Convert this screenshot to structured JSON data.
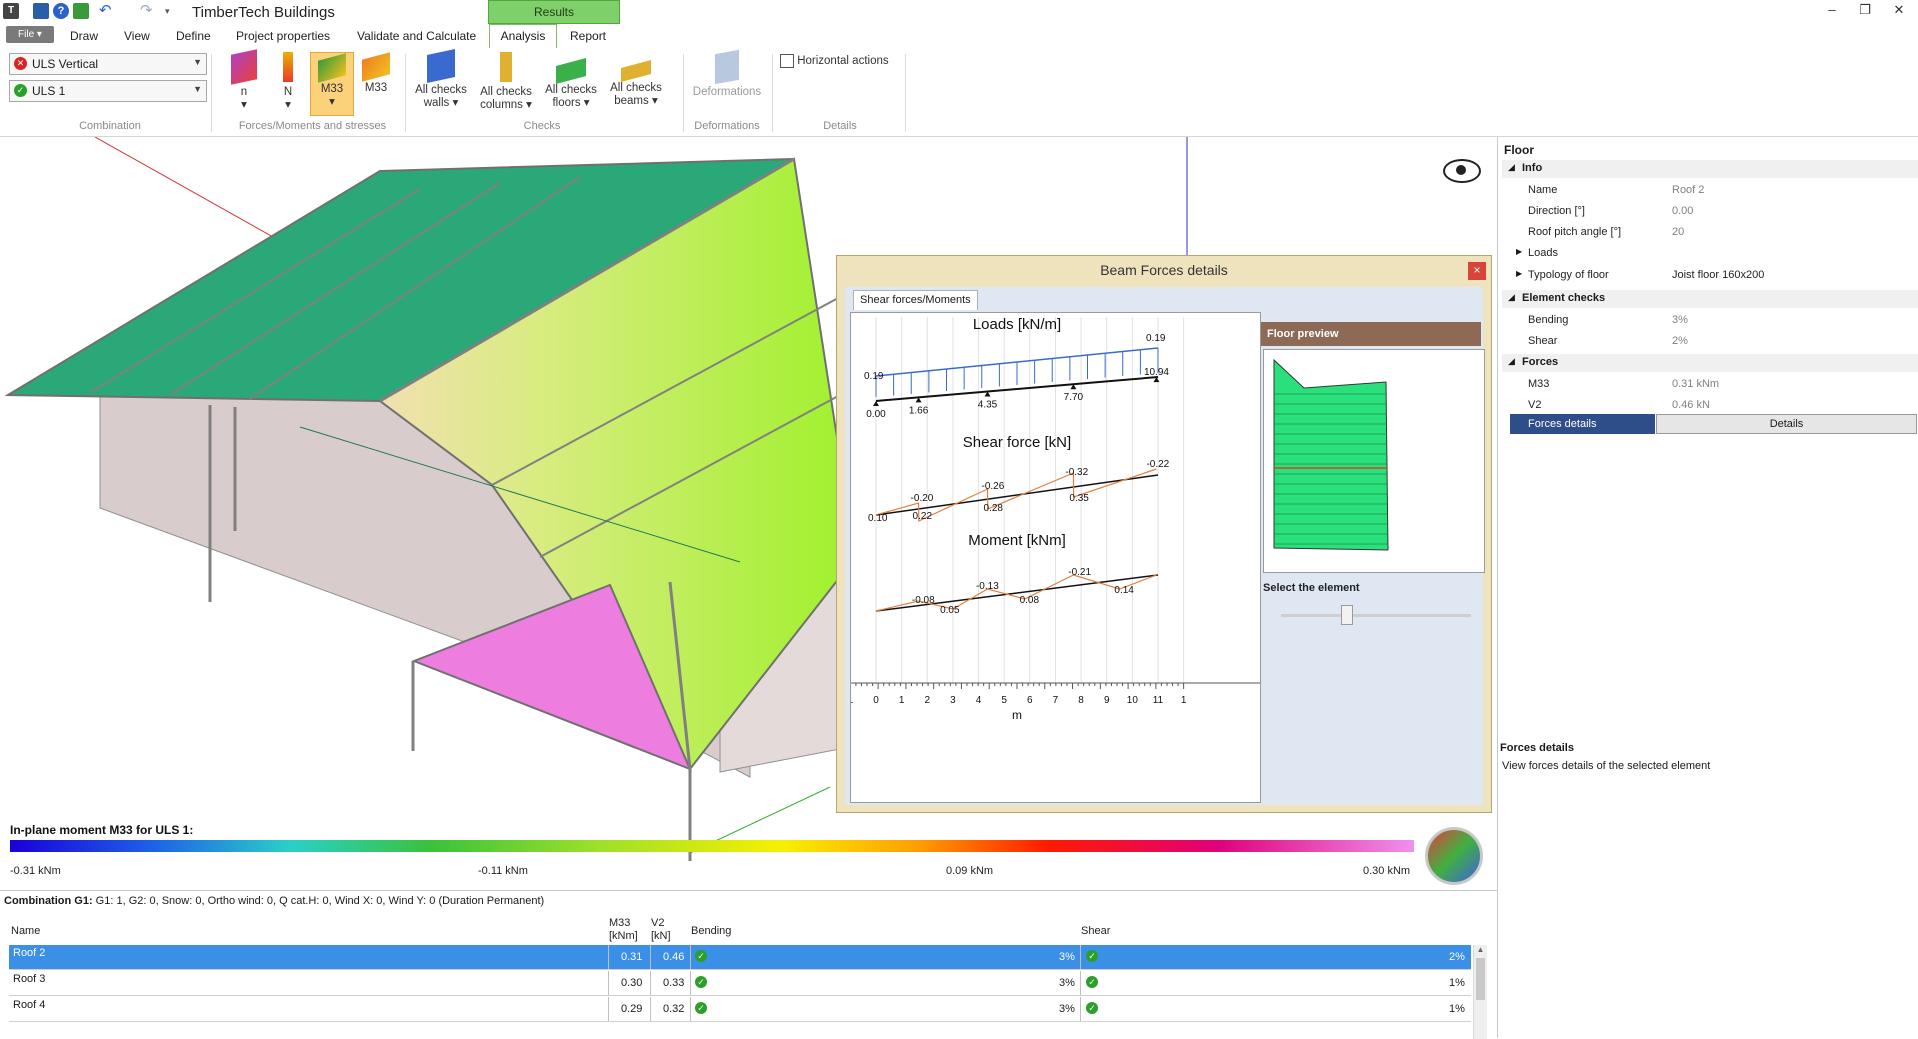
{
  "app": {
    "title": "TimberTech Buildings",
    "context_tab": "Results",
    "quick_access_icons": [
      "app-icon",
      "save-icon",
      "help-icon",
      "export-icon",
      "undo-icon",
      "redo-icon",
      "more-icon"
    ]
  },
  "tabs": [
    "Draw",
    "View",
    "Define",
    "Project properties",
    "Validate and Calculate",
    "Analysis",
    "Report"
  ],
  "file_tab": "File",
  "active_tab": "Analysis",
  "ribbon": {
    "combination_group": {
      "combo1": "ULS Vertical",
      "combo2": "ULS 1",
      "label": "Combination"
    },
    "forces_group": {
      "buttons": [
        "n",
        "N",
        "M33",
        "M33"
      ],
      "label": "Forces/Moments and stresses"
    },
    "checks_group": {
      "buttons": [
        {
          "line1": "All checks",
          "line2": "walls"
        },
        {
          "line1": "All checks",
          "line2": "columns"
        },
        {
          "line1": "All checks",
          "line2": "floors"
        },
        {
          "line1": "All checks",
          "line2": "beams"
        }
      ],
      "label": "Checks"
    },
    "deformations_group": {
      "button": "Deformations",
      "label": "Deformations"
    },
    "details_group": {
      "button": "Horizontal actions",
      "label": "Details"
    }
  },
  "legend": {
    "title": "In-plane moment M33 for ULS 1:",
    "values": [
      "-0.31 kNm",
      "-0.11 kNm",
      "0.09 kNm",
      "0.30 kNm"
    ]
  },
  "dialog": {
    "title": "Beam Forces details",
    "close": "×",
    "tab": "Shear forces/Moments",
    "preview_title": "Floor preview",
    "select_label": "Select the element",
    "slider_value": 0.3
  },
  "chart_data": [
    {
      "type": "line",
      "title": "Loads [kN/m]",
      "x_positions": [
        0.0,
        1.66,
        4.35,
        7.7,
        10.94
      ],
      "load_start": 0.19,
      "load_end": 0.19
    },
    {
      "type": "line",
      "title": "Shear force [kN]",
      "values_labels": [
        "0.10",
        "-0.20",
        "0.22",
        "-0.26",
        "0.28",
        "-0.32",
        "0.35",
        "-0.22"
      ]
    },
    {
      "type": "line",
      "title": "Moment [kNm]",
      "values_labels": [
        "-0.08",
        "0.05",
        "-0.13",
        "0.08",
        "-0.21",
        "0.14"
      ]
    }
  ],
  "chart_axis": {
    "ticks": [
      "1",
      "0",
      "1",
      "2",
      "3",
      "4",
      "5",
      "6",
      "7",
      "8",
      "9",
      "10",
      "11",
      "1"
    ],
    "unit": "m"
  },
  "props": {
    "title": "Floor",
    "info_section": "Info",
    "info_rows": [
      {
        "k": "Name",
        "v": "Roof 2"
      },
      {
        "k": "Direction [°]",
        "v": "0.00"
      },
      {
        "k": "Roof pitch angle [°]",
        "v": "20"
      },
      {
        "k": "Loads",
        "v": ""
      },
      {
        "k": "Typology of floor",
        "v": "Joist floor 160x200"
      }
    ],
    "checks_section": "Element checks",
    "checks_rows": [
      {
        "k": "Bending",
        "v": "3%"
      },
      {
        "k": "Shear",
        "v": "2%"
      }
    ],
    "forces_section": "Forces",
    "forces_rows": [
      {
        "k": "M33",
        "v": "0.31 kNm"
      },
      {
        "k": "V2",
        "v": "0.46 kN"
      }
    ],
    "forces_details_label": "Forces details",
    "details_button": "Details",
    "desc_title": "Forces details",
    "desc_text": "View forces details of the selected element"
  },
  "grid": {
    "combination_text": "Combination G1:",
    "combination_desc": "G1: 1, G2: 0, Snow: 0, Ortho wind: 0, Q cat.H: 0, Wind X: 0, Wind Y: 0 (Duration Permanent)",
    "col_name": "Name",
    "col_m33": "M33",
    "col_m33_unit": "[kNm]",
    "col_v2": "V2",
    "col_v2_unit": "[kN]",
    "col_bending": "Bending",
    "col_shear": "Shear",
    "rows": [
      {
        "name": "Roof 2",
        "m33": "0.31",
        "v2": "0.46",
        "bending": "3%",
        "shear": "2%"
      },
      {
        "name": "Roof 3",
        "m33": "0.30",
        "v2": "0.33",
        "bending": "3%",
        "shear": "1%"
      },
      {
        "name": "Roof 4",
        "m33": "0.29",
        "v2": "0.32",
        "bending": "3%",
        "shear": "1%"
      }
    ]
  }
}
